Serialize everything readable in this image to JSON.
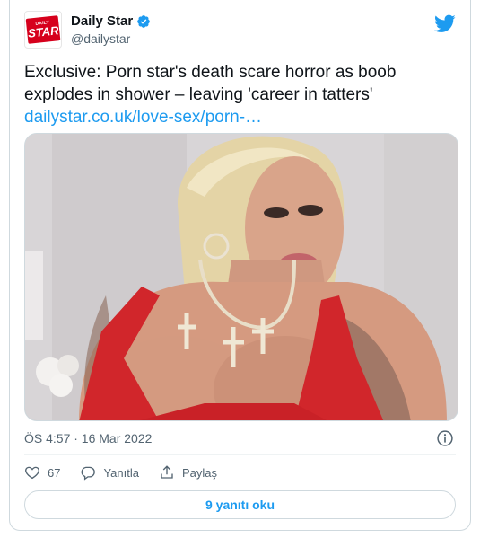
{
  "author": {
    "display_name": "Daily Star",
    "handle": "@dailystar",
    "verified": true,
    "logo_small": "DAILY",
    "logo_big": "STAR"
  },
  "tweet": {
    "text": "Exclusive: Porn star's death scare horror as boob explodes in shower – leaving 'career in tatters' ",
    "link": "dailystar.co.uk/love-sex/porn-…",
    "timestamp": "ÖS 4:57 · 16 Mar 2022"
  },
  "actions": {
    "likes": "67",
    "reply_label": "Yanıtla",
    "share_label": "Paylaş"
  },
  "more_button": "9 yanıtı oku",
  "colors": {
    "accent": "#1d9bf0",
    "secondary_text": "#536471",
    "brand_red": "#d6001c"
  },
  "icons": [
    "twitter-bird-icon",
    "verified-badge-icon",
    "info-icon",
    "heart-icon",
    "reply-icon",
    "share-icon"
  ]
}
